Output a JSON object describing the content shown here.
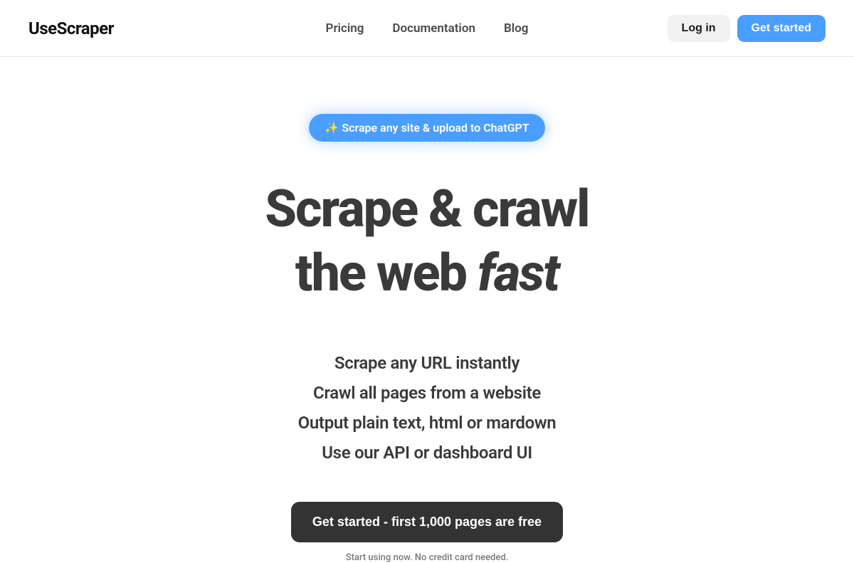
{
  "header": {
    "logo": "UseScraper",
    "nav": {
      "pricing": "Pricing",
      "documentation": "Documentation",
      "blog": "Blog"
    },
    "login": "Log in",
    "get_started": "Get started"
  },
  "hero": {
    "pill_sparkle": "✨",
    "pill_text": "Scrape any site & upload to ChatGPT",
    "headline_line1": "Scrape & crawl",
    "headline_line2_pre": "the web ",
    "headline_line2_italic": "fast",
    "features": {
      "f1": "Scrape any URL instantly",
      "f2": "Crawl all pages from a website",
      "f3": "Output plain text, html or mardown",
      "f4": "Use our API or dashboard UI"
    },
    "cta": "Get started - first 1,000 pages are free",
    "subnote": "Start using now. No credit card needed."
  }
}
